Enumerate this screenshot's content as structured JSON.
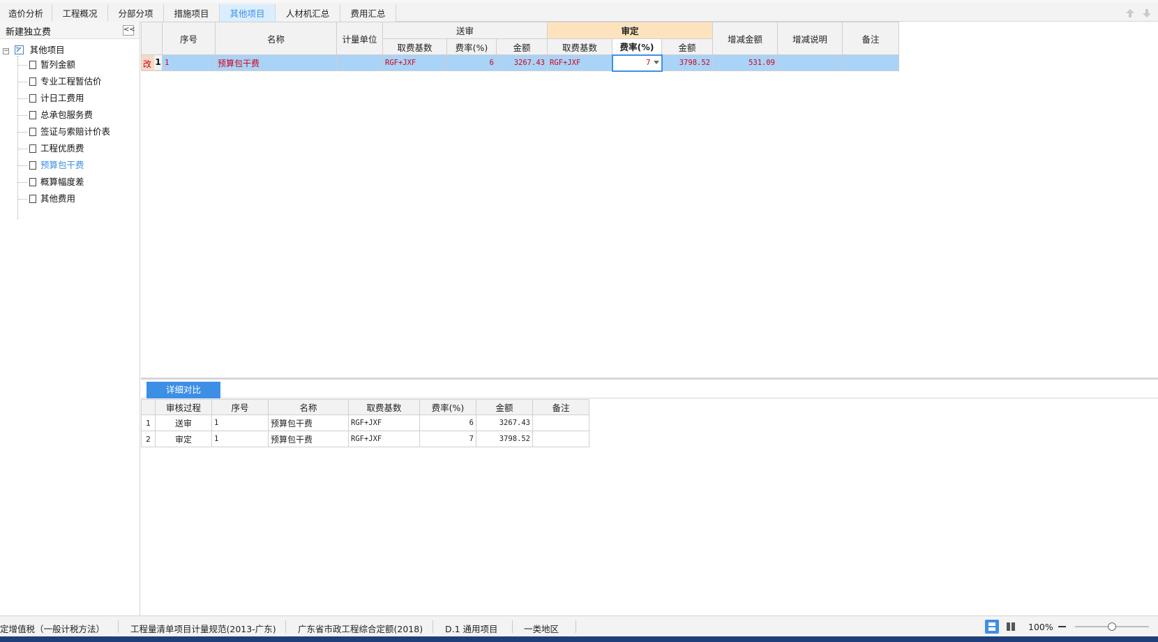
{
  "tabs": [
    {
      "label": "造价分析"
    },
    {
      "label": "工程概况"
    },
    {
      "label": "分部分项"
    },
    {
      "label": "措施项目"
    },
    {
      "label": "其他项目"
    },
    {
      "label": "人材机汇总"
    },
    {
      "label": "费用汇总"
    }
  ],
  "active_tab": "其他项目",
  "left": {
    "title": "新建独立费",
    "collapse_glyph": "<<",
    "root_label": "其他项目",
    "items": [
      {
        "label": "暂列金额"
      },
      {
        "label": "专业工程暂估价"
      },
      {
        "label": "计日工费用"
      },
      {
        "label": "总承包服务费"
      },
      {
        "label": "签证与索赔计价表"
      },
      {
        "label": "工程优质费"
      },
      {
        "label": "预算包干费"
      },
      {
        "label": "概算幅度差"
      },
      {
        "label": "其他费用"
      }
    ],
    "selected_item": "预算包干费"
  },
  "main_grid": {
    "headers": {
      "seq": "序号",
      "name": "名称",
      "unit": "计量单位",
      "submitted": "送审",
      "approved": "审定",
      "sub_base": "取费基数",
      "sub_rate": "费率(%)",
      "sub_amount": "金额",
      "app_base": "取费基数",
      "app_rate": "费率(%)",
      "app_amount": "金额",
      "diff": "增减金额",
      "diff_note": "增减说明",
      "remark": "备注"
    },
    "row": {
      "flag": "改",
      "row_no": "1",
      "seq": "1",
      "name": "预算包干费",
      "unit": "",
      "sub_base": "RGF+JXF",
      "sub_rate": "6",
      "sub_amount": "3267.43",
      "app_base": "RGF+JXF",
      "app_rate": "7",
      "app_amount": "3798.52",
      "diff": "531.09",
      "diff_note": "",
      "remark": ""
    }
  },
  "detail": {
    "tab_label": "详细对比",
    "headers": {
      "process": "审核过程",
      "seq": "序号",
      "name": "名称",
      "base": "取费基数",
      "rate": "费率(%)",
      "amount": "金额",
      "remark": "备注"
    },
    "rows": [
      {
        "no": "1",
        "process": "送审",
        "seq": "1",
        "name": "预算包干费",
        "base": "RGF+JXF",
        "rate": "6",
        "amount": "3267.43",
        "remark": ""
      },
      {
        "no": "2",
        "process": "审定",
        "seq": "1",
        "name": "预算包干费",
        "base": "RGF+JXF",
        "rate": "7",
        "amount": "3798.52",
        "remark": ""
      }
    ]
  },
  "status": {
    "items": [
      {
        "label": "定增值税（一般计税方法）"
      },
      {
        "label": "工程量清单项目计量规范(2013-广东)"
      },
      {
        "label": "广东省市政工程综合定额(2018)"
      },
      {
        "label": "D.1 通用项目"
      },
      {
        "label": "一类地区"
      }
    ],
    "zoom": "100%",
    "zoom_level": 0.5
  },
  "colors": {
    "accent": "#3d8fe6",
    "selected_row": "#a9d3f7",
    "approved_header": "#fde3bd",
    "modified_text": "#d0021b"
  }
}
